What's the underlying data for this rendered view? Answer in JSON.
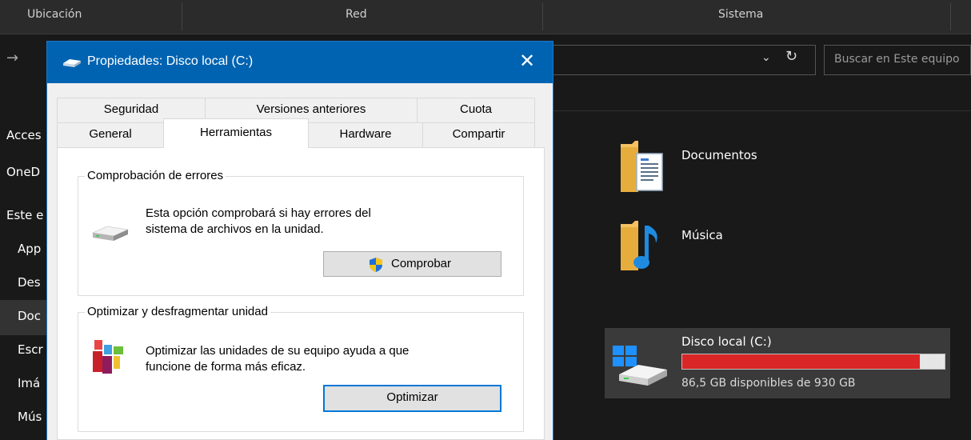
{
  "explorer": {
    "ribbon_groups": [
      "Ubicación",
      "Red",
      "Sistema"
    ],
    "search_placeholder": "Buscar en Este equipo",
    "nav": [
      "Acces",
      "OneD",
      "Este e",
      "App",
      "Des",
      "Doc",
      "Escr",
      "Imá",
      "Mús"
    ],
    "folders": [
      {
        "name": "Documentos",
        "icon": "documents-folder-icon"
      },
      {
        "name": "Música",
        "icon": "music-folder-icon"
      }
    ],
    "drive": {
      "name": "Disco local (C:)",
      "free_text": "86,5 GB disponibles de 930 GB",
      "used_fraction": 0.907,
      "bar_color": "#da2626"
    }
  },
  "dialog": {
    "title": "Propiedades: Disco local (C:)",
    "tabs_row1": [
      "Seguridad",
      "Versiones anteriores",
      "Cuota"
    ],
    "tabs_row2": [
      "General",
      "Herramientas",
      "Hardware",
      "Compartir"
    ],
    "active_tab": "Herramientas",
    "error_check": {
      "title": "Comprobación de errores",
      "line1": "Esta opción comprobará si hay errores del",
      "line2": "sistema de archivos en la unidad.",
      "button": "Comprobar"
    },
    "optimize": {
      "title": "Optimizar y desfragmentar unidad",
      "line1": "Optimizar las unidades de su equipo ayuda a que",
      "line2": "funcione de forma más eficaz.",
      "button": "Optimizar"
    },
    "accent_color": "#0063b1"
  }
}
